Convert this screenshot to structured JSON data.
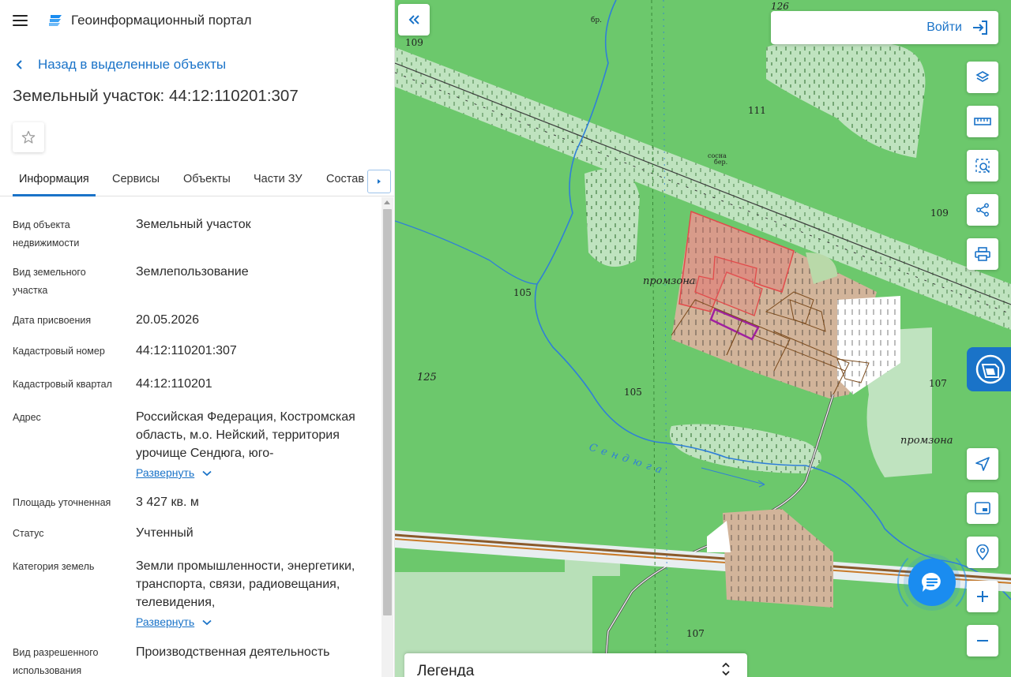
{
  "header": {
    "title": "Геоинформационный портал"
  },
  "back_link": "Назад в выделенные объекты",
  "object_title": "Земельный участок: 44:12:110201:307",
  "tabs": [
    {
      "label": "Информация",
      "active": true
    },
    {
      "label": "Сервисы"
    },
    {
      "label": "Объекты"
    },
    {
      "label": "Части ЗУ"
    },
    {
      "label": "Состав"
    }
  ],
  "expand_label": "Развернуть",
  "properties": [
    {
      "label": "Вид объекта недвижимости",
      "value": "Земельный участок"
    },
    {
      "label": "Вид земельного участка",
      "value": "Землепользование"
    },
    {
      "label": "Дата присвоения",
      "value": "20.05.2026"
    },
    {
      "label": "Кадастровый номер",
      "value": "44:12:110201:307"
    },
    {
      "label": "Кадастровый квартал",
      "value": "44:12:110201"
    },
    {
      "label": "Адрес",
      "value": "Российская Федерация, Костромская область, м.о. Нейский, территория урочище Сендюга, юго-"
    },
    {
      "label": "Площадь уточненная",
      "value": "3 427 кв. м"
    },
    {
      "label": "Статус",
      "value": "Учтенный"
    },
    {
      "label": "Категория земель",
      "value": "Земли промышленности, энергетики, транспорта, связи, радиовещания, телевидения,"
    },
    {
      "label": "Вид разрешенного использования",
      "value": "Производственная деятельность"
    }
  ],
  "map": {
    "login_label": "Войти",
    "legend_label": "Легенда",
    "labels": {
      "l126": "126",
      "l109a": "109",
      "l109b": "109",
      "l111": "111",
      "lbr": "бр.",
      "lsosna": "сосна",
      "lber": "бер.",
      "lpromzona1": "промзона",
      "lpromzona2": "промзона",
      "l105a": "105",
      "l105b": "105",
      "l125": "125",
      "l107a": "107",
      "l107b": "107",
      "lriver": "Сендюга"
    },
    "colors": {
      "forest": "#6cc86c",
      "clearing": "#bfe3bf",
      "parcel_fill": "#d2b49a",
      "parcel_selected": "#e14b4b",
      "highlight": "#a020a0",
      "river": "#2f7fd8",
      "railway": "#8a5a2b",
      "accent": "#1a73c8"
    }
  },
  "icons": {
    "layers": "layers-icon",
    "ruler": "ruler-icon",
    "select": "select-area-icon",
    "share": "share-icon",
    "print": "print-icon",
    "locate": "locate-icon",
    "minimap": "minimap-icon",
    "geo_search": "geo-search-icon",
    "zoom_in": "zoom-in-icon",
    "zoom_out": "zoom-out-icon"
  }
}
